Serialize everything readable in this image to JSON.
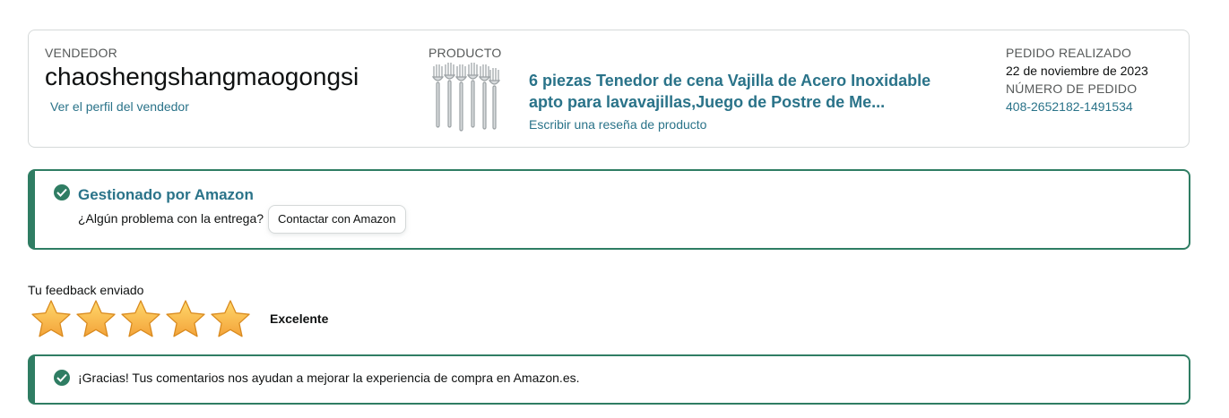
{
  "order": {
    "seller_label": "VENDEDOR",
    "seller_name": "chaoshengshangmaogongsi",
    "seller_profile_link": "Ver el perfil del vendedor",
    "product_label": "PRODUCTO",
    "product_title_line1": "6 piezas Tenedor de cena Vajilla de Acero Inoxidable",
    "product_title_line2": "apto para lavavajillas,Juego de Postre de Me...",
    "product_image_icon": "forks-image",
    "review_link": "Escribir una reseña de producto",
    "order_date_label": "PEDIDO REALIZADO",
    "order_date": "22 de noviembre de 2023",
    "order_number_label": "NÚMERO DE PEDIDO",
    "order_number": "408-2652182-1491534"
  },
  "fulfillment": {
    "icon": "check-circle-icon",
    "title": "Gestionado por Amazon",
    "question": "¿Algún problema con la entrega?",
    "contact_button": "Contactar con Amazon"
  },
  "feedback": {
    "label": "Tu feedback enviado",
    "rating": 5,
    "max_rating": 5,
    "rating_word": "Excelente"
  },
  "thanks": {
    "icon": "check-circle-icon",
    "message": "¡Gracias! Tus comentarios nos ayudan a mejorar la experiencia de compra en Amazon.es."
  },
  "colors": {
    "link": "#2a7389",
    "success": "#2f7d63",
    "star": "#f3a847",
    "border": "#d5d9d9"
  }
}
